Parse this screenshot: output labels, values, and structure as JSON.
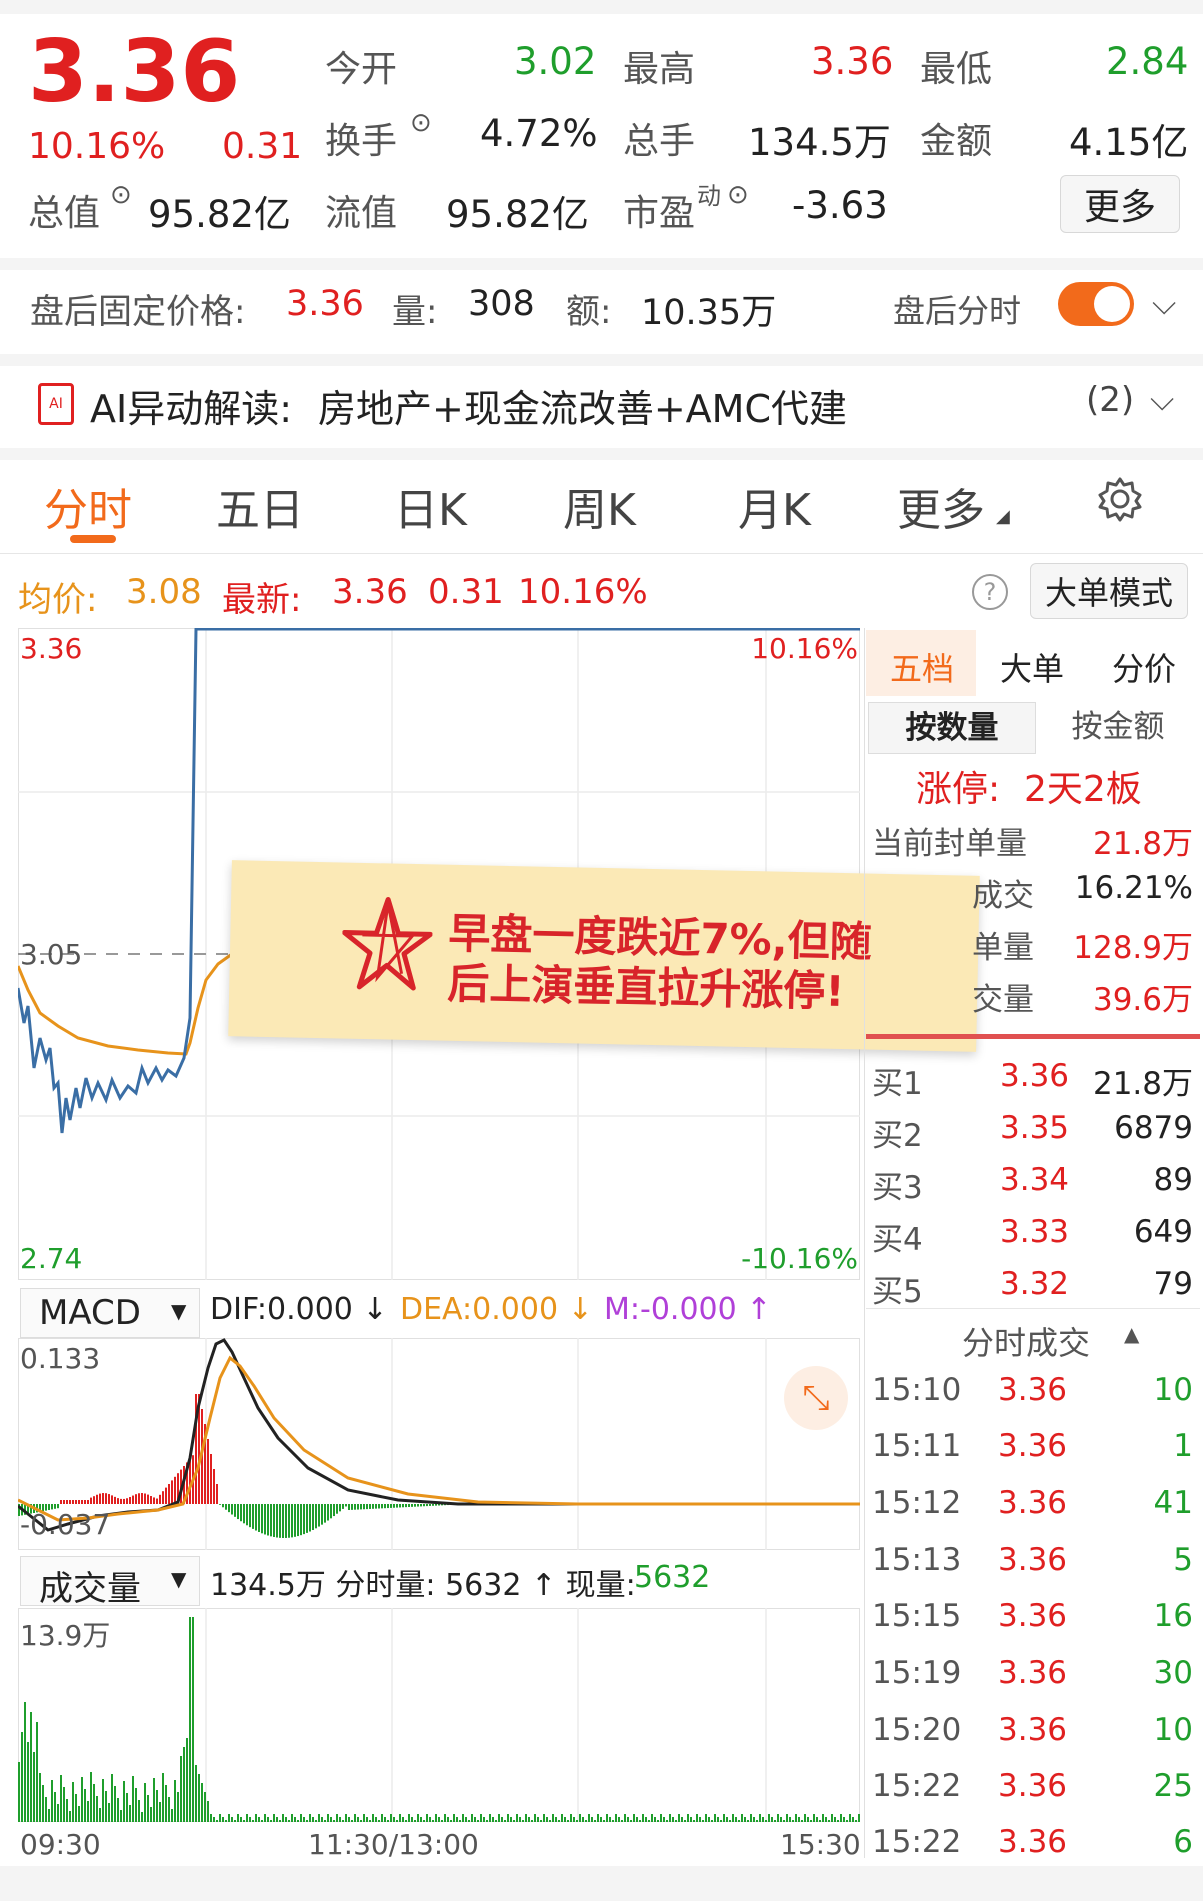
{
  "quote": {
    "price": "3.36",
    "change_pct": "10.16%",
    "change": "0.31",
    "open_label": "今开",
    "open": "3.02",
    "high_label": "最高",
    "high": "3.36",
    "low_label": "最低",
    "low": "2.84",
    "turnover_label": "换手",
    "turnover": "4.72%",
    "volume_label": "总手",
    "volume": "134.5万",
    "amount_label": "金额",
    "amount": "4.15亿",
    "mktcap_label": "总值",
    "mktcap": "95.82亿",
    "float_label": "流值",
    "float_cap": "95.82亿",
    "pe_label": "市盈",
    "pe_sup": "动",
    "pe": "-3.63",
    "more_button": "更多"
  },
  "after_hours": {
    "price_label": "盘后固定价格:",
    "price": "3.36",
    "vol_label": "量:",
    "vol": "308",
    "amt_label": "额:",
    "amt": "10.35万",
    "timeshare_label": "盘后分时",
    "toggle_on": true
  },
  "ai_banner": {
    "title": "AI异动解读:",
    "text": "房地产+现金流改善+AMC代建",
    "count": "(2)"
  },
  "tabs": [
    "分时",
    "五日",
    "日K",
    "周K",
    "月K",
    "更多"
  ],
  "active_tab": 0,
  "info_bar": {
    "avg_label": "均价:",
    "avg": "3.08",
    "latest_label": "最新:",
    "latest": "3.36",
    "change": "0.31",
    "pct": "10.16%",
    "bigorder_button": "大单模式"
  },
  "price_chart": {
    "y_top": "3.36",
    "y_mid": "3.05",
    "y_bot": "2.74",
    "pct_top": "10.16%",
    "pct_bot": "-10.16%"
  },
  "overlay_note": "早盘一度跌近7%,但随后上演垂直拉升涨停!",
  "overlay_lines": [
    "早盘一度跌近7%,但随",
    "后上演垂直拉升涨停!"
  ],
  "macd": {
    "selector": "MACD",
    "dif": "DIF:0.000 ↓",
    "dea": "DEA:0.000 ↓",
    "m": "M:-0.000 ↑",
    "y_top": "0.133",
    "y_bot": "-0.037"
  },
  "volume_panel": {
    "selector": "成交量",
    "summary": "134.5万 分时量: 5632 ↑ 现量:",
    "current": "5632",
    "y_top": "13.9万"
  },
  "time_axis": [
    "09:30",
    "11:30/13:00",
    "15:30"
  ],
  "right_panel": {
    "tabs": [
      "五档",
      "大单",
      "分价"
    ],
    "subtabs": [
      "按数量",
      "按金额"
    ],
    "limit_label": "涨停:",
    "limit_value": "2天2板",
    "stats": [
      {
        "label": "当前封单量",
        "value": "21.8万"
      },
      {
        "label": "成交",
        "value": "16.21%"
      },
      {
        "label": "单量",
        "value": "128.9万"
      },
      {
        "label": "交量",
        "value": "39.6万"
      }
    ],
    "bids": [
      {
        "label": "买1",
        "price": "3.36",
        "vol": "21.8万"
      },
      {
        "label": "买2",
        "price": "3.35",
        "vol": "6879"
      },
      {
        "label": "买3",
        "price": "3.34",
        "vol": "89"
      },
      {
        "label": "买4",
        "price": "3.33",
        "vol": "649"
      },
      {
        "label": "买5",
        "price": "3.32",
        "vol": "79"
      }
    ],
    "trades_title": "分时成交",
    "trades": [
      {
        "time": "15:10",
        "price": "3.36",
        "vol": "10"
      },
      {
        "time": "15:11",
        "price": "3.36",
        "vol": "1"
      },
      {
        "time": "15:12",
        "price": "3.36",
        "vol": "41"
      },
      {
        "time": "15:13",
        "price": "3.36",
        "vol": "5"
      },
      {
        "time": "15:15",
        "price": "3.36",
        "vol": "16"
      },
      {
        "time": "15:19",
        "price": "3.36",
        "vol": "30"
      },
      {
        "time": "15:20",
        "price": "3.36",
        "vol": "10"
      },
      {
        "time": "15:22",
        "price": "3.36",
        "vol": "25"
      },
      {
        "time": "15:22",
        "price": "3.36",
        "vol": "6"
      }
    ]
  },
  "colors": {
    "up": "#e02020",
    "down": "#1f9e2c",
    "price_line": "#3a6ea5",
    "avg_line": "#e7931b"
  }
}
